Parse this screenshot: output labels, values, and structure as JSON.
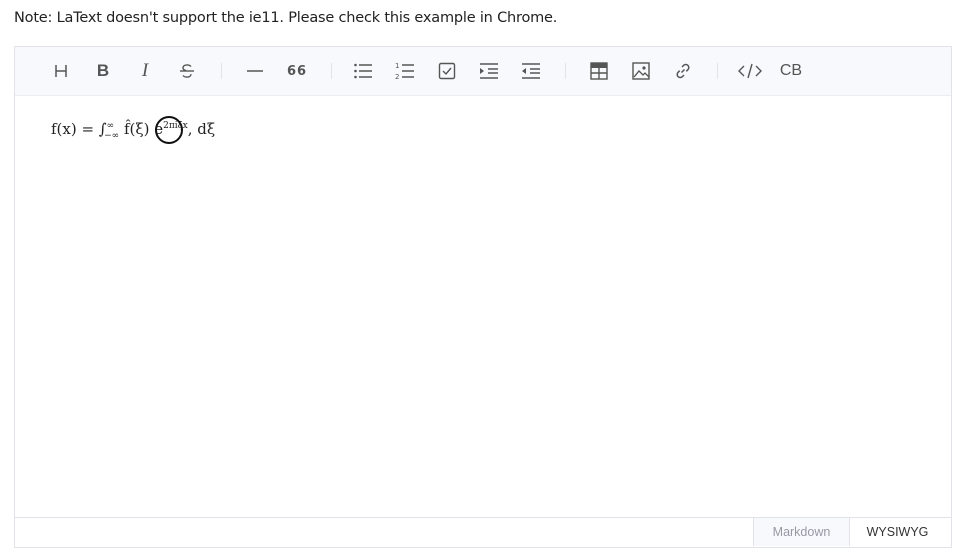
{
  "note": "Note: LaText doesn't support the ie11. Please check this example in Chrome.",
  "toolbar": {
    "heading_label": "H",
    "bold_label": "B",
    "italic_label": "I",
    "strike_label": "S",
    "quote_label": "66",
    "custom_label": "CB"
  },
  "content": {
    "formula_prefix": "f(x) = ∫",
    "formula_sup": "∞",
    "formula_sub": "−∞",
    "formula_mid": " f̂(ξ)",
    "formula_e": "e",
    "formula_exp": "2πiξx",
    "formula_tail": ", dξ"
  },
  "footer": {
    "markdown_label": "Markdown",
    "wysiwyg_label": "WYSIWYG"
  },
  "colors": {
    "toolbar_bg": "#f7f9fc",
    "border": "#e1e3e9",
    "icon": "#555555",
    "inactive_tab_text": "#969aa5"
  }
}
